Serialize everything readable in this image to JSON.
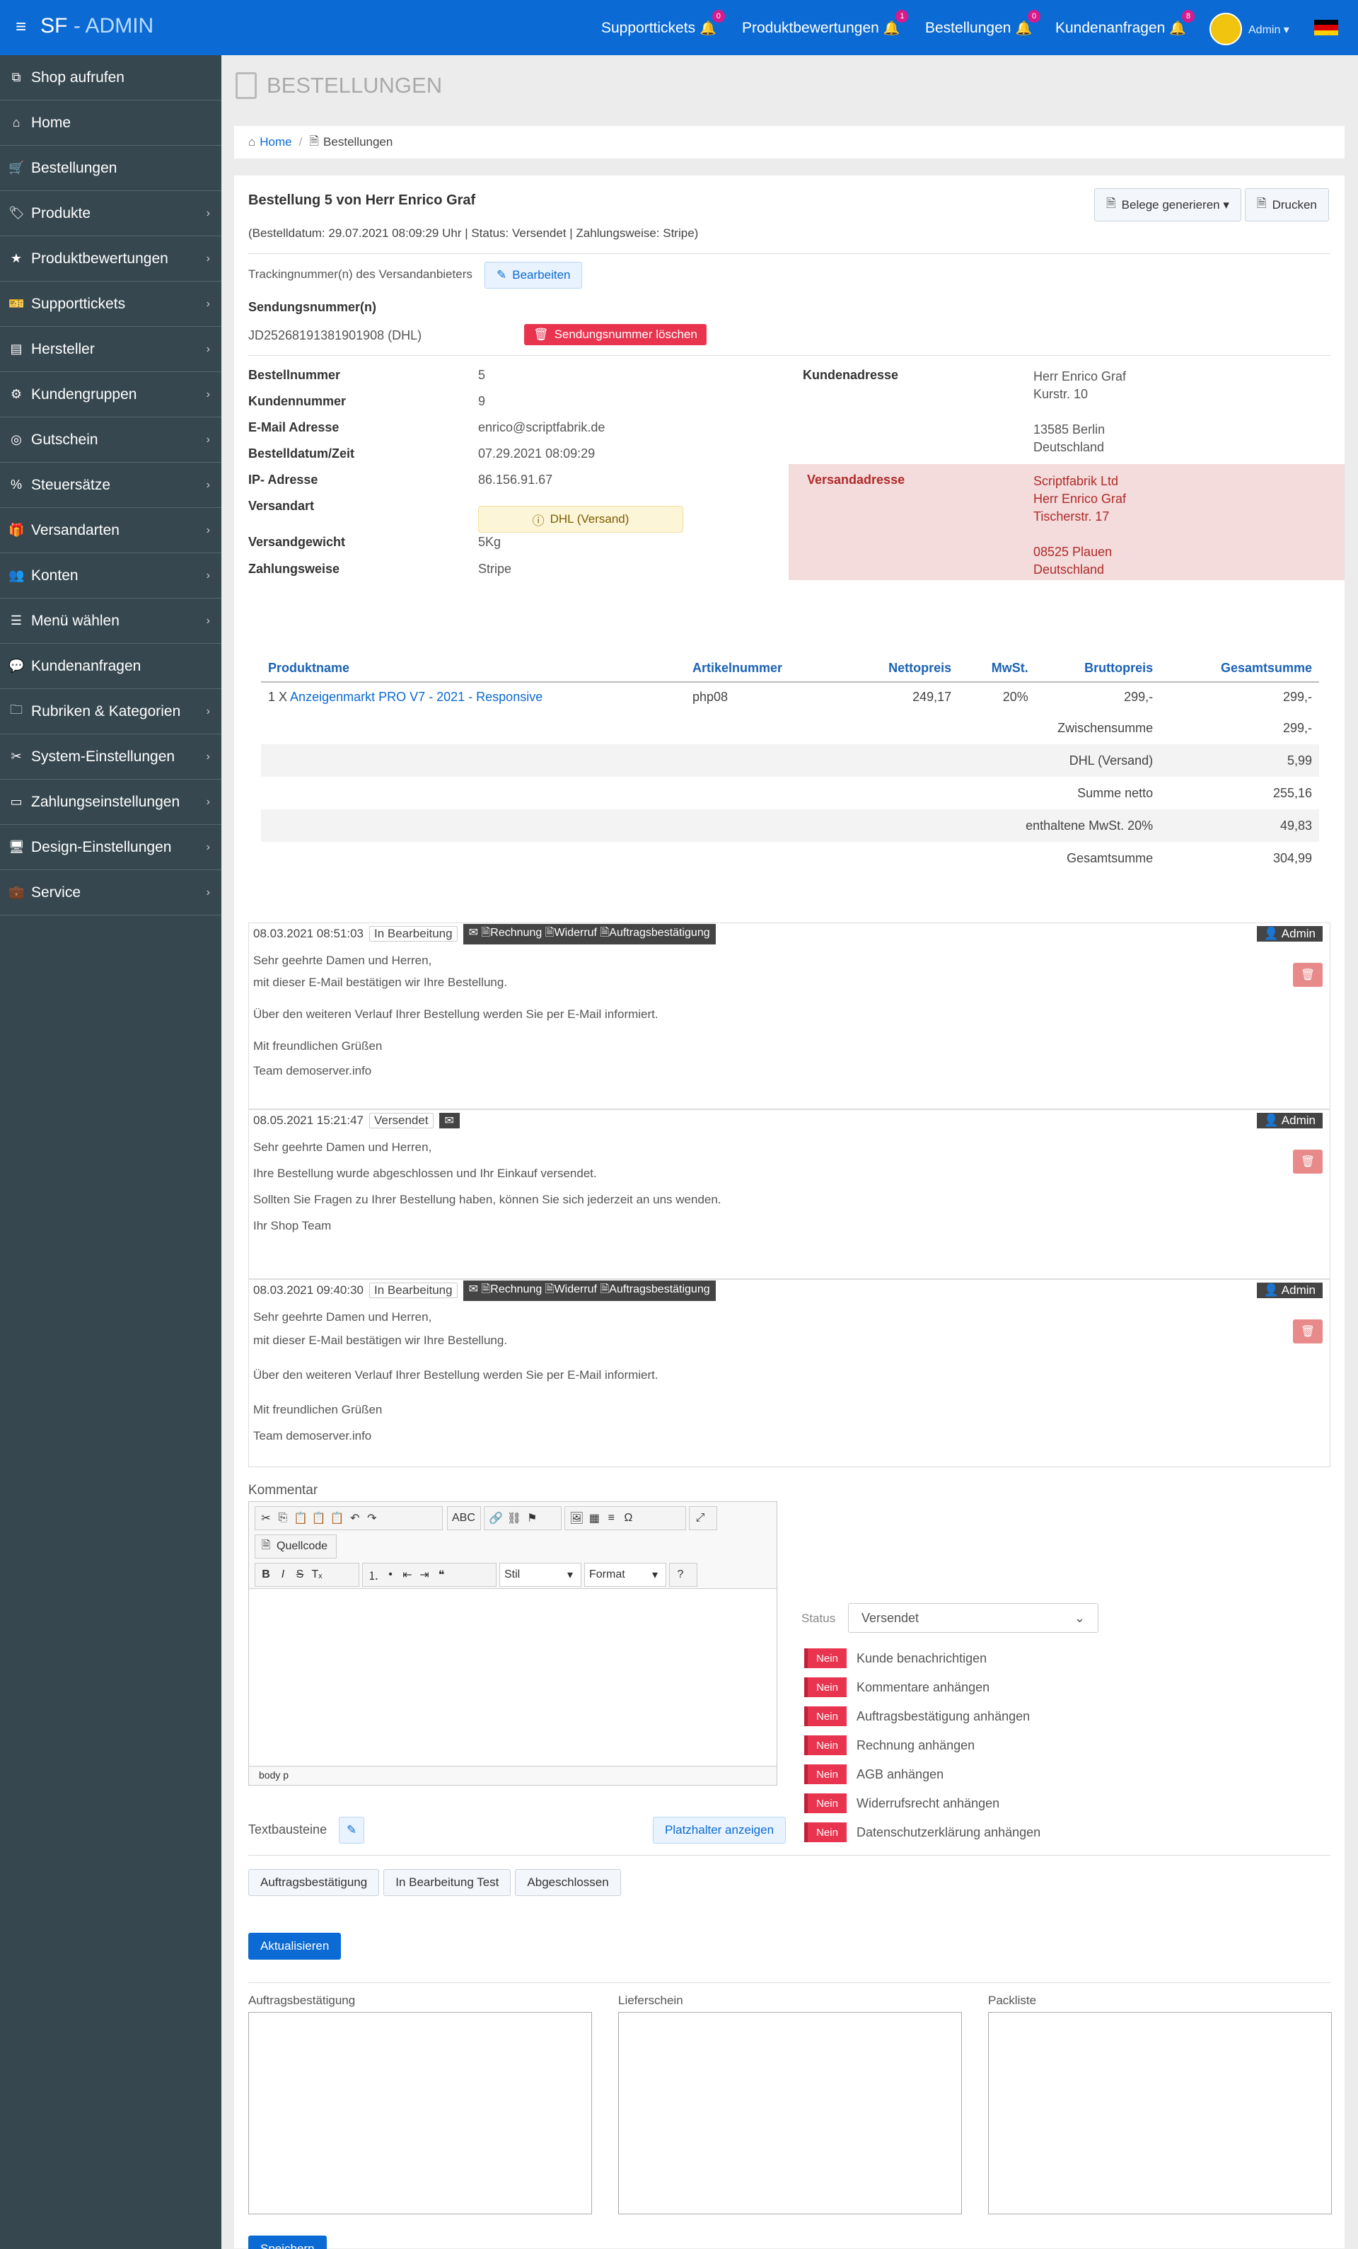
{
  "topbar": {
    "brand_sf": "SF",
    "brand_dash": "-",
    "brand_admin": "ADMIN",
    "nav": [
      {
        "label": "Supporttickets",
        "count": "0"
      },
      {
        "label": "Produktbewertungen",
        "count": "1"
      },
      {
        "label": "Bestellungen",
        "count": "0"
      },
      {
        "label": "Kundenanfragen",
        "count": "8"
      }
    ],
    "user": "Admin"
  },
  "sidebar": {
    "items": [
      {
        "label": "Shop aufrufen",
        "icon": "external-link-icon"
      },
      {
        "label": "Home",
        "icon": "home-icon"
      },
      {
        "label": "Bestellungen",
        "icon": "cart-icon"
      },
      {
        "label": "Produkte",
        "icon": "tag-icon"
      },
      {
        "label": "Produktbewertungen",
        "icon": "star-icon"
      },
      {
        "label": "Supporttickets",
        "icon": "ticket-icon"
      },
      {
        "label": "Hersteller",
        "icon": "building-icon"
      },
      {
        "label": "Kundengruppen",
        "icon": "users-cog-icon"
      },
      {
        "label": "Gutschein",
        "icon": "globe-icon"
      },
      {
        "label": "Steuersätze",
        "icon": "percent-icon"
      },
      {
        "label": "Versandarten",
        "icon": "gift-icon"
      },
      {
        "label": "Konten",
        "icon": "users-icon"
      },
      {
        "label": "Menü wählen",
        "icon": "list-icon"
      },
      {
        "label": "Kundenanfragen",
        "icon": "comment-icon"
      },
      {
        "label": "Rubriken & Kategorien",
        "icon": "folder-icon"
      },
      {
        "label": "System-Einstellungen",
        "icon": "tools-icon"
      },
      {
        "label": "Zahlungseinstellungen",
        "icon": "credit-card-icon"
      },
      {
        "label": "Design-Einstellungen",
        "icon": "desktop-icon"
      },
      {
        "label": "Service",
        "icon": "briefcase-icon"
      }
    ]
  },
  "page": {
    "title": "BESTELLUNGEN",
    "breadcrumb_home": "Home",
    "breadcrumb_current": "Bestellungen"
  },
  "order": {
    "heading": "Bestellung 5 von Herr Enrico Graf",
    "subline": "(Bestelldatum: 29.07.2021 08:09:29 Uhr | Status: Versendet | Zahlungsweise: Stripe)",
    "btn_belege": "Belege generieren ▾",
    "btn_drucken": "Drucken",
    "tracking_label": "Trackingnummer(n) des Versandanbieters",
    "btn_bearbeiten": "Bearbeiten",
    "sendungs_label": "Sendungsnummer(n)",
    "sendungs_value": "JD25268191381901908 (DHL)",
    "btn_sendung_loeschen": "Sendungsnummer löschen",
    "fields": {
      "bestellnummer_l": "Bestellnummer",
      "bestellnummer_v": "5",
      "kundennummer_l": "Kundennummer",
      "kundennummer_v": "9",
      "email_l": "E-Mail Adresse",
      "email_v": "enrico@scriptfabrik.de",
      "datum_l": "Bestelldatum/Zeit",
      "datum_v": "07.29.2021 08:09:29",
      "ip_l": "IP- Adresse",
      "ip_v": "86.156.91.67",
      "versandart_l": "Versandart",
      "versandart_v": "DHL (Versand)",
      "gewicht_l": "Versandgewicht",
      "gewicht_v": "5Kg",
      "zahlung_l": "Zahlungsweise",
      "zahlung_v": "Stripe"
    },
    "kundenadresse_label": "Kundenadresse",
    "kundenadresse": [
      "Herr Enrico Graf",
      "Kurstr. 10",
      "",
      "13585 Berlin",
      "Deutschland"
    ],
    "versandadresse_label": "Versandadresse",
    "versandadresse": [
      "Scriptfabrik Ltd",
      "Herr Enrico Graf",
      "Tischerstr. 17",
      "",
      "08525 Plauen",
      "Deutschland"
    ]
  },
  "products": {
    "headers": [
      "Produktname",
      "Artikelnummer",
      "Nettopreis",
      "MwSt.",
      "Bruttopreis",
      "Gesamtsumme"
    ],
    "row": {
      "qty": "1 X",
      "name": "Anzeigenmarkt PRO V7 - 2021 - Responsive",
      "sku": "php08",
      "netto": "249,17",
      "mwst": "20%",
      "brutto": "299,-",
      "total": "299,-"
    },
    "sums": [
      {
        "label": "Zwischensumme",
        "value": "299,-"
      },
      {
        "label": "DHL (Versand)",
        "value": "5,99"
      },
      {
        "label": "Summe netto",
        "value": "255,16"
      },
      {
        "label": "enthaltene MwSt. 20%",
        "value": "49,83"
      },
      {
        "label": "Gesamtsumme",
        "value": "304,99"
      }
    ]
  },
  "logs": [
    {
      "date": "08.03.2021 08:51:03",
      "status": "In Bearbeitung",
      "tags": "✉ 🗎Rechnung 🗎Widerruf 🗎Auftragsbestätigung",
      "user": "👤 Admin",
      "lines": [
        "Sehr geehrte Damen und Herren,",
        "mit dieser E-Mail bestätigen wir Ihre Bestellung.",
        "Über den weiteren Verlauf Ihrer Bestellung werden Sie per E-Mail informiert.",
        "Mit freundlichen Grüßen",
        "Team demoserver.info"
      ]
    },
    {
      "date": "08.05.2021 15:21:47",
      "status": "Versendet",
      "tags": "✉",
      "user": "👤 Admin",
      "lines": [
        "Sehr geehrte Damen und Herren,",
        "Ihre Bestellung wurde abgeschlossen und Ihr Einkauf versendet.",
        "Sollten Sie Fragen zu Ihrer Bestellung haben, können Sie sich jederzeit an uns wenden.",
        "Ihr Shop Team"
      ]
    },
    {
      "date": "08.03.2021 09:40:30",
      "status": "In Bearbeitung",
      "tags": "✉ 🗎Rechnung 🗎Widerruf 🗎Auftragsbestätigung",
      "user": "👤 Admin",
      "lines": [
        "Sehr geehrte Damen und Herren,",
        "mit dieser E-Mail bestätigen wir Ihre Bestellung.",
        "Über den weiteren Verlauf Ihrer Bestellung werden Sie per E-Mail informiert.",
        "Mit freundlichen Grüßen",
        "Team demoserver.info"
      ]
    }
  ],
  "comment": {
    "label": "Kommentar",
    "quellcode": "Quellcode",
    "stil": "Stil",
    "format": "Format",
    "footer": "body  p"
  },
  "status": {
    "label": "Status",
    "selected": "Versendet",
    "nein": "Nein",
    "toggles": [
      "Kunde benachrichtigen",
      "Kommentare anhängen",
      "Auftragsbestätigung anhängen",
      "Rechnung anhängen",
      "AGB anhängen",
      "Widerrufsrecht anhängen",
      "Datenschutzerklärung anhängen"
    ]
  },
  "textbausteine": {
    "label": "Textbausteine",
    "btn_platzhalter": "Platzhalter anzeigen",
    "presets": [
      "Auftragsbestätigung",
      "In Bearbeitung Test",
      "Abgeschlossen"
    ],
    "btn_update": "Aktualisieren"
  },
  "documents": {
    "labels": [
      "Auftragsbestätigung",
      "Lieferschein",
      "Packliste"
    ],
    "btn_save": "Speichern"
  }
}
